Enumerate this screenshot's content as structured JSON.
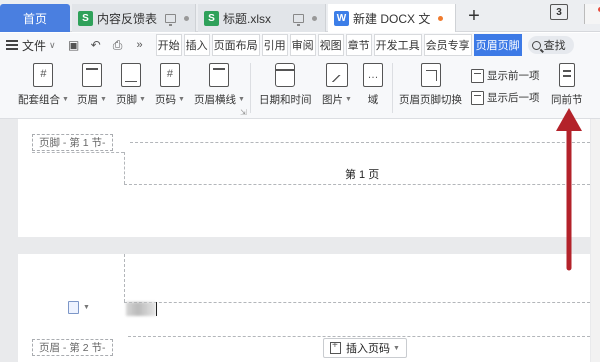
{
  "tabs": {
    "home": "首页",
    "items": [
      {
        "label": "内容反馈表",
        "icon": "S"
      },
      {
        "label": "标题.xlsx",
        "icon": "S"
      },
      {
        "label": "新建 DOCX 文",
        "icon": "W"
      }
    ],
    "add": "+",
    "badge": "3"
  },
  "menu": {
    "file": "文件",
    "items": [
      "开始",
      "插入",
      "页面布局",
      "引用",
      "审阅",
      "视图",
      "章节",
      "开发工具",
      "会员专享",
      "页眉页脚"
    ],
    "active_index": 9,
    "search": "查找"
  },
  "ribbon": {
    "buttons": [
      "配套组合",
      "页眉",
      "页脚",
      "页码",
      "页眉横线",
      "日期和时间",
      "图片",
      "域",
      "页眉页脚切换",
      "同前节"
    ],
    "nav_prev": "显示前一项",
    "nav_next": "显示后一项"
  },
  "document": {
    "footer_tag_1": "页脚 - 第 1 节-",
    "page_label": "第 1 页",
    "header_tag_2": "页眉 - 第 2 节-",
    "insert_page_number": "插入页码"
  },
  "colors": {
    "accent": "#3d7ae6",
    "annotation_arrow": "#b3222a"
  }
}
